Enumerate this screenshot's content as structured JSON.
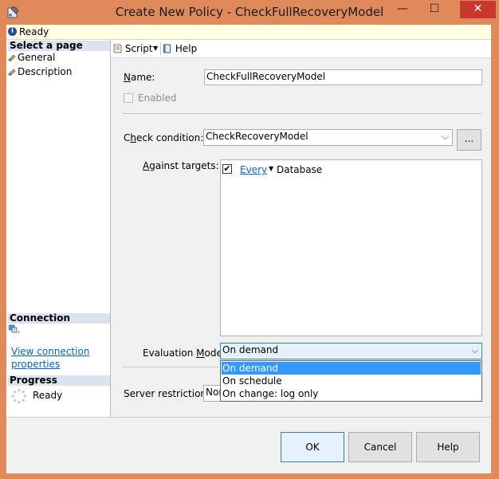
{
  "window": {
    "title": "Create New Policy - CheckFullRecoveryModel",
    "minimize_glyph": "—",
    "maximize_glyph": "☐",
    "close_glyph": "✕"
  },
  "status": {
    "text": "Ready"
  },
  "left": {
    "select_page_header": "Select a page",
    "pages": [
      "General",
      "Description"
    ],
    "connection_header": "Connection",
    "connection_name": ".",
    "view_connection_line1": "View connection",
    "view_connection_line2": "properties",
    "progress_header": "Progress",
    "progress_text": "Ready"
  },
  "toolbar": {
    "script_label": "Script",
    "help_label": "Help"
  },
  "form": {
    "name_label_u": "N",
    "name_label_rest": "ame:",
    "name_value": "CheckFullRecoveryModel",
    "enabled_label": "Enabled",
    "enabled_checked": false,
    "check_condition_label_pre": "C",
    "check_condition_label_u": "h",
    "check_condition_label_rest": "eck condition:",
    "check_condition_value": "CheckRecoveryModel",
    "browse_label": "...",
    "against_targets_label_u": "A",
    "against_targets_label_rest": "gainst targets:",
    "target_every": "Every",
    "target_db": "Database",
    "target_checked": true,
    "evaluation_mode_label_pre": "Evaluation ",
    "evaluation_mode_label_u": "M",
    "evaluation_mode_label_rest": "ode:",
    "evaluation_mode_value": "On demand",
    "evaluation_mode_options": [
      "On demand",
      "On schedule",
      "On change: log only"
    ],
    "server_restriction_label": "Server restriction",
    "server_restriction_value": "Nor"
  },
  "buttons": {
    "ok": "OK",
    "cancel": "Cancel",
    "help": "Help"
  }
}
